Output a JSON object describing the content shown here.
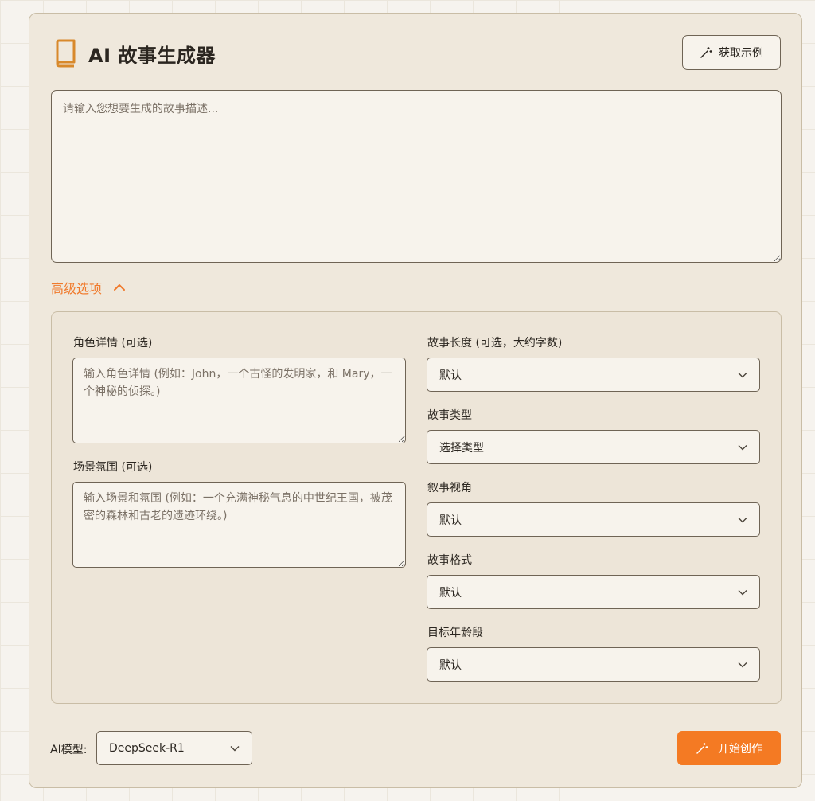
{
  "header": {
    "title": "AI 故事生成器",
    "example_button": "获取示例",
    "icon": "book-icon"
  },
  "story_input": {
    "placeholder": "请输入您想要生成的故事描述..."
  },
  "advanced": {
    "toggle_label": "高级选项",
    "characters": {
      "label": "角色详情 (可选)",
      "placeholder": "输入角色详情 (例如：John，一个古怪的发明家，和 Mary，一个神秘的侦探。)"
    },
    "setting": {
      "label": "场景氛围 (可选)",
      "placeholder": "输入场景和氛围 (例如：一个充满神秘气息的中世纪王国，被茂密的森林和古老的遗迹环绕。)"
    },
    "length": {
      "label": "故事长度 (可选，大约字数)",
      "value": "默认"
    },
    "genre": {
      "label": "故事类型",
      "value": "选择类型"
    },
    "perspective": {
      "label": "叙事视角",
      "value": "默认"
    },
    "format": {
      "label": "故事格式",
      "value": "默认"
    },
    "age": {
      "label": "目标年龄段",
      "value": "默认"
    }
  },
  "footer": {
    "model_label": "AI模型:",
    "model_value": "DeepSeek-R1",
    "start_button": "开始创作"
  },
  "colors": {
    "accent": "#f47a23",
    "card_bg": "#efe8dc",
    "border": "#6f6455"
  }
}
